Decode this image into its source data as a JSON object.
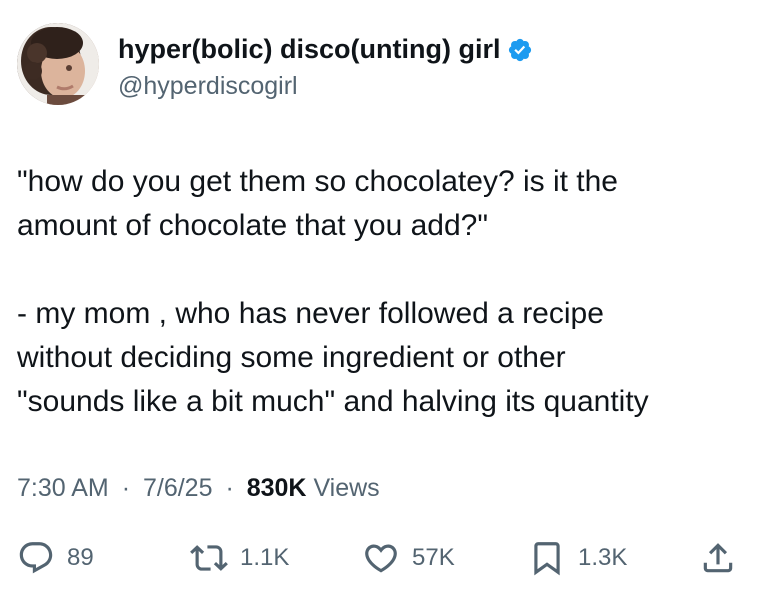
{
  "author": {
    "display_name": "hyper(bolic) disco(unting) girl",
    "handle": "@hyperdiscogirl",
    "verified": true
  },
  "tweet": {
    "paragraphs": [
      [
        "\"how do you get them so chocolatey? is it the",
        "amount of chocolate that you add?\""
      ],
      [
        "- my mom , who has never followed a recipe",
        "without deciding some ingredient or other",
        "\"sounds like a bit much\" and halving its quantity"
      ]
    ]
  },
  "meta": {
    "time": "7:30 AM",
    "date": "7/6/25",
    "separator": "·",
    "views_count": "830K",
    "views_label": "Views"
  },
  "actions": {
    "reply_count": "89",
    "retweet_count": "1.1K",
    "like_count": "57K",
    "bookmark_count": "1.3K"
  },
  "colors": {
    "text": "#0f1419",
    "secondary": "#536471",
    "verified_badge": "#1d9bf0"
  }
}
